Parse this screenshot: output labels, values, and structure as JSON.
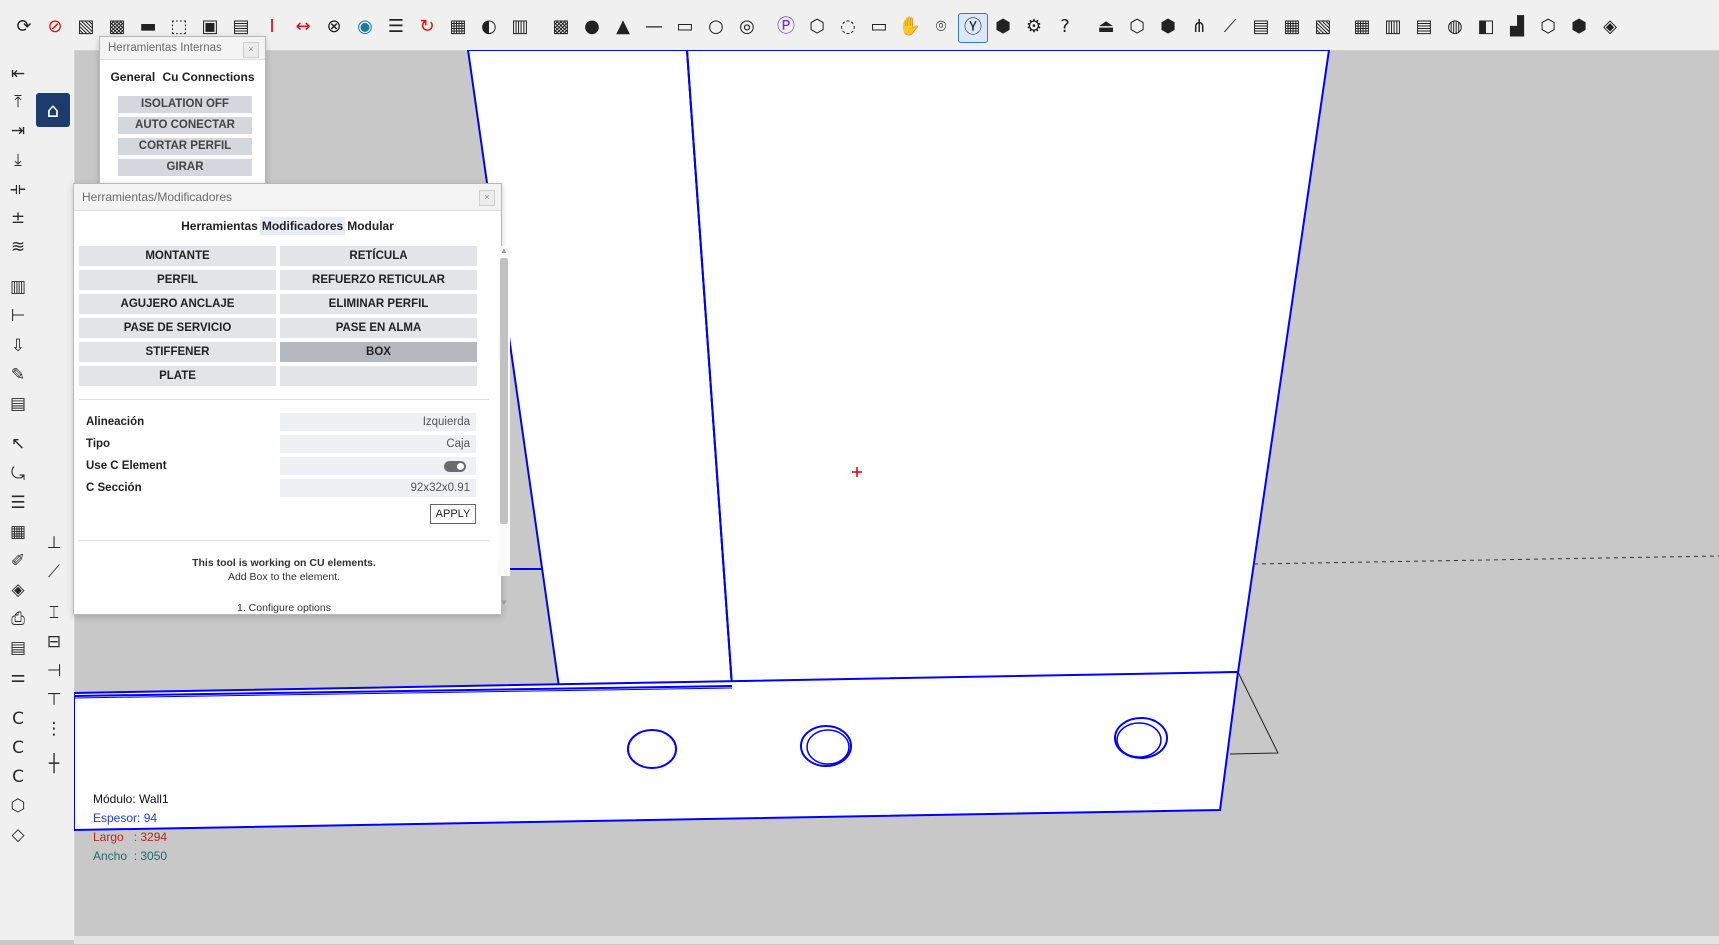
{
  "colors": {
    "accent": "#3a78c8",
    "model_edge": "#0000ff",
    "espesor": "#1f3fd0",
    "largo": "#c0241c",
    "ancho": "#1f6a6a"
  },
  "toolbar_icons": [
    "rotate-icon",
    "no-entry-icon",
    "sheet-icon",
    "block-icon",
    "eraser-icon",
    "select-dashed-icon",
    "sin-icon",
    "dfi-icon",
    "beam-i-icon",
    "double-arrow-icon",
    "hide-icon",
    "target-icon",
    "checklist-icon",
    "redo-icon",
    "texture-icon",
    "style-icon",
    "ver-ran-icon",
    "grid-icon",
    "dot-icon",
    "triangle-icon",
    "line-icon",
    "rectangle-icon",
    "circle-icon",
    "eye-hide-icon",
    "plugin-p-icon",
    "iso-box-icon",
    "orbit-icon",
    "camera-video-icon",
    "pan-icon",
    "camera-icon",
    "y-axis-icon",
    "cube-icon",
    "settings-icon",
    "help-icon",
    "section-icon",
    "cube-outline-icon",
    "cube-open-icon",
    "fan-icon",
    "ruler-icon",
    "note-icon",
    "tile-icon",
    "tile2-icon",
    "grid-table-icon",
    "columns-icon",
    "layers-icon",
    "profile-icon",
    "shapes-icon",
    "stair-icon",
    "cube-top-icon",
    "cube-front-icon",
    "cube-iso-icon"
  ],
  "internal_panel": {
    "title": "Herramientas Internas",
    "tabs": [
      "General",
      "Cu Connections"
    ],
    "buttons": [
      "ISOLATION OFF",
      "AUTO CONECTAR",
      "CORTAR PERFIL",
      "GIRAR"
    ]
  },
  "mod_panel": {
    "title": "Herramientas/Modificadores",
    "tabs": [
      "Herramientas",
      "Modificadores",
      "Modular"
    ],
    "active_tab": "Modificadores",
    "buttons": [
      {
        "label": "MONTANTE",
        "active": false
      },
      {
        "label": "RETÍCULA",
        "active": false
      },
      {
        "label": "PERFIL",
        "active": false
      },
      {
        "label": "REFUERZO RETICULAR",
        "active": false
      },
      {
        "label": "AGUJERO ANCLAJE",
        "active": false
      },
      {
        "label": "ELIMINAR PERFIL",
        "active": false
      },
      {
        "label": "PASE DE SERVICIO",
        "active": false
      },
      {
        "label": "PASE EN ALMA",
        "active": false
      },
      {
        "label": "STIFFENER",
        "active": false
      },
      {
        "label": "BOX",
        "active": true
      },
      {
        "label": "PLATE",
        "active": false
      },
      {
        "label": "",
        "active": false
      }
    ],
    "props": {
      "alineacion": {
        "label": "Alineación",
        "value": "Izquierda"
      },
      "tipo": {
        "label": "Tipo",
        "value": "Caja"
      },
      "use_c": {
        "label": "Use C Element",
        "value": true
      },
      "c_seccion": {
        "label": "C Sección",
        "value": "92x32x0.91"
      }
    },
    "apply_label": "APPLY",
    "info_line1": "This tool is working on CU elements.",
    "info_line2": "Add Box to the element.",
    "info_line3": "1. Configure options"
  },
  "module_info": {
    "modulo": "Módulo: Wall1",
    "espesor": "Espesor: 94",
    "largo": "Largo   : 3294",
    "ancho": "Ancho  : 3050"
  }
}
